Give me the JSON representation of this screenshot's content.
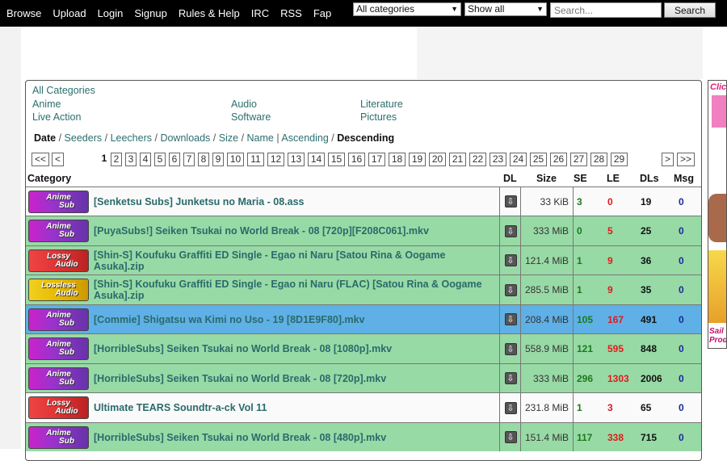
{
  "nav": {
    "links": [
      "Browse",
      "Upload",
      "Login",
      "Signup",
      "Rules & Help",
      "IRC",
      "RSS",
      "Fap"
    ],
    "category_select": "All categories",
    "filter_select": "Show all",
    "search_placeholder": "Search...",
    "search_button": "Search"
  },
  "categories": {
    "all": "All Categories",
    "anime": "Anime",
    "audio": "Audio",
    "literature": "Literature",
    "live_action": "Live Action",
    "software": "Software",
    "pictures": "Pictures"
  },
  "sort": {
    "date": "Date",
    "seeders": "Seeders",
    "leechers": "Leechers",
    "downloads": "Downloads",
    "size": "Size",
    "name": "Name",
    "ascending": "Ascending",
    "descending": "Descending",
    "sep": "/",
    "bar": "|"
  },
  "pager": {
    "first": "<<",
    "prev": "<",
    "next": ">",
    "last": ">>",
    "current": "1",
    "pages": [
      "2",
      "3",
      "4",
      "5",
      "6",
      "7",
      "8",
      "9",
      "10",
      "11",
      "12",
      "13",
      "14",
      "15",
      "16",
      "17",
      "18",
      "19",
      "20",
      "21",
      "22",
      "23",
      "24",
      "25",
      "26",
      "27",
      "28",
      "29"
    ]
  },
  "table": {
    "headers": {
      "category": "Category",
      "dl": "DL",
      "size": "Size",
      "se": "SE",
      "le": "LE",
      "dls": "DLs",
      "msg": "Msg"
    },
    "rows": [
      {
        "badge1": "Anime",
        "badge2": "Sub",
        "badge": "anime",
        "name": "[Senketsu Subs] Junketsu no Maria - 08.ass",
        "size": "33 KiB",
        "se": "3",
        "le": "0",
        "dls": "19",
        "msg": "0",
        "color": "white"
      },
      {
        "badge1": "Anime",
        "badge2": "Sub",
        "badge": "anime",
        "name": "[PuyaSubs!] Seiken Tsukai no World Break - 08 [720p][F208C061].mkv",
        "size": "333 MiB",
        "se": "0",
        "le": "5",
        "dls": "25",
        "msg": "0",
        "color": "green"
      },
      {
        "badge1": "Lossy",
        "badge2": "Audio",
        "badge": "lossy",
        "name": "[Shin-S] Koufuku Graffiti ED Single - Egao ni Naru [Satou Rina & Oogame Asuka].zip",
        "size": "121.4 MiB",
        "se": "1",
        "le": "9",
        "dls": "36",
        "msg": "0",
        "color": "green"
      },
      {
        "badge1": "Lossless",
        "badge2": "Audio",
        "badge": "lossless",
        "name": "[Shin-S] Koufuku Graffiti ED Single - Egao ni Naru (FLAC) [Satou Rina & Oogame Asuka].zip",
        "size": "285.5 MiB",
        "se": "1",
        "le": "9",
        "dls": "35",
        "msg": "0",
        "color": "green"
      },
      {
        "badge1": "Anime",
        "badge2": "Sub",
        "badge": "anime",
        "name": "[Commie] Shigatsu wa Kimi no Uso - 19 [8D1E9F80].mkv",
        "size": "208.4 MiB",
        "se": "105",
        "le": "167",
        "dls": "491",
        "msg": "0",
        "color": "blue"
      },
      {
        "badge1": "Anime",
        "badge2": "Sub",
        "badge": "anime",
        "name": "[HorribleSubs] Seiken Tsukai no World Break - 08 [1080p].mkv",
        "size": "558.9 MiB",
        "se": "121",
        "le": "595",
        "dls": "848",
        "msg": "0",
        "color": "green"
      },
      {
        "badge1": "Anime",
        "badge2": "Sub",
        "badge": "anime",
        "name": "[HorribleSubs] Seiken Tsukai no World Break - 08 [720p].mkv",
        "size": "333 MiB",
        "se": "296",
        "le": "1303",
        "dls": "2006",
        "msg": "0",
        "color": "green"
      },
      {
        "badge1": "Lossy",
        "badge2": "Audio",
        "badge": "lossy",
        "name": "Ultimate TEARS Soundtr-a-ck Vol 11",
        "size": "231.8 MiB",
        "se": "1",
        "le": "3",
        "dls": "65",
        "msg": "0",
        "color": "white"
      },
      {
        "badge1": "Anime",
        "badge2": "Sub",
        "badge": "anime",
        "name": "[HorribleSubs] Seiken Tsukai no World Break - 08 [480p].mkv",
        "size": "151.4 MiB",
        "se": "117",
        "le": "338",
        "dls": "715",
        "msg": "0",
        "color": "green"
      }
    ]
  },
  "ad": {
    "top_text": "Clic",
    "bottom_line1": "Sail",
    "bottom_line2": "Prod"
  }
}
